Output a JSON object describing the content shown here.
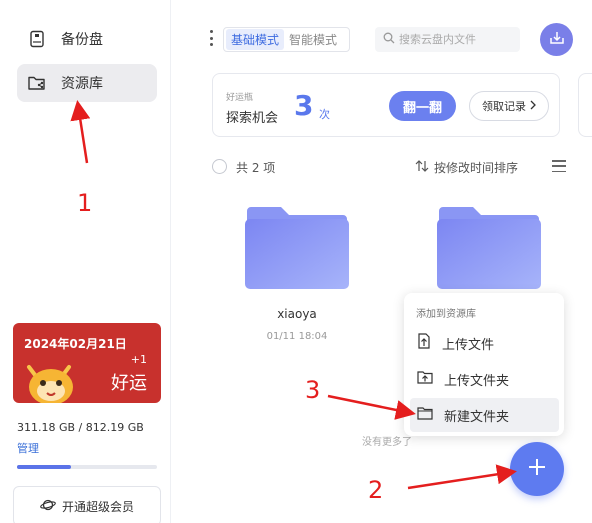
{
  "sidebar": {
    "items": [
      {
        "label": "备份盘",
        "icon": "backup-disk-icon"
      },
      {
        "label": "资源库",
        "icon": "resource-folder-icon"
      }
    ],
    "promo": {
      "date": "2024年02月21日",
      "plus": "+1",
      "text": "好运"
    },
    "storage": "311.18 GB / 812.19 GB",
    "storage_used_fraction": 0.383,
    "manage_label": "管理",
    "vip_label": "开通超级会员"
  },
  "toolbar": {
    "mode_basic": "基础模式",
    "mode_smart": "智能模式",
    "search_placeholder": "搜索云盘内文件"
  },
  "activity": {
    "small_label": "好运瓶",
    "title": "探索机会",
    "count": "3",
    "unit": "次",
    "flip_label": "翻一翻",
    "record_label": "领取记录"
  },
  "list": {
    "count_label": "共 2 项",
    "sort_label": "按修改时间排序",
    "folders": [
      {
        "name": "xiaoya",
        "date": "01/11 18:04"
      },
      {
        "name": "",
        "date": ""
      }
    ],
    "no_more": "没有更多了"
  },
  "popup": {
    "header": "添加到资源库",
    "options": [
      {
        "label": "上传文件",
        "icon": "upload-file-icon"
      },
      {
        "label": "上传文件夹",
        "icon": "upload-folder-icon"
      },
      {
        "label": "新建文件夹",
        "icon": "new-folder-icon"
      }
    ]
  },
  "annotations": [
    "1",
    "2",
    "3"
  ],
  "colors": {
    "accent": "#5e7bf0",
    "promo": "#c8312d",
    "annotation": "#e41e1e"
  }
}
